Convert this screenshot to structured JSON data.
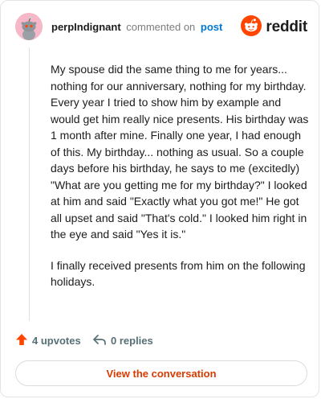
{
  "comment": {
    "username": "perpIndignant",
    "verb": "commented on",
    "post_link": "post",
    "paragraphs": [
      "My spouse did the same thing to me for years... nothing for our anniversary, nothing for my birthday. Every year I tried to show him by example and would get him really nice presents. His birthday was 1 month after mine. Finally one year, I had enough of this. My birthday... nothing as usual. So a couple days before his birthday, he says to me (excitedly) \"What are you getting me for my birthday?\" I looked at him and said \"Exactly what you got me!\" He got all upset and said \"That's cold.\" I looked him right in the eye and said \"Yes it is.\"",
      "I finally received presents from him on the following holidays."
    ]
  },
  "brand": {
    "name": "reddit",
    "accent": "#ff4500"
  },
  "actions": {
    "upvotes_label": "4 upvotes",
    "replies_label": "0 replies",
    "view_conversation_label": "View the conversation"
  },
  "icons": {
    "upvote": "upvote-arrow-icon",
    "reply": "reply-arrow-icon",
    "logo": "reddit-snoo-icon",
    "avatar": "snoo-avatar-icon"
  },
  "colors": {
    "link": "#0079d3",
    "upvote": "#ff4500",
    "button_text": "#d93a00",
    "avatar_bg": "#f6b8c8"
  }
}
